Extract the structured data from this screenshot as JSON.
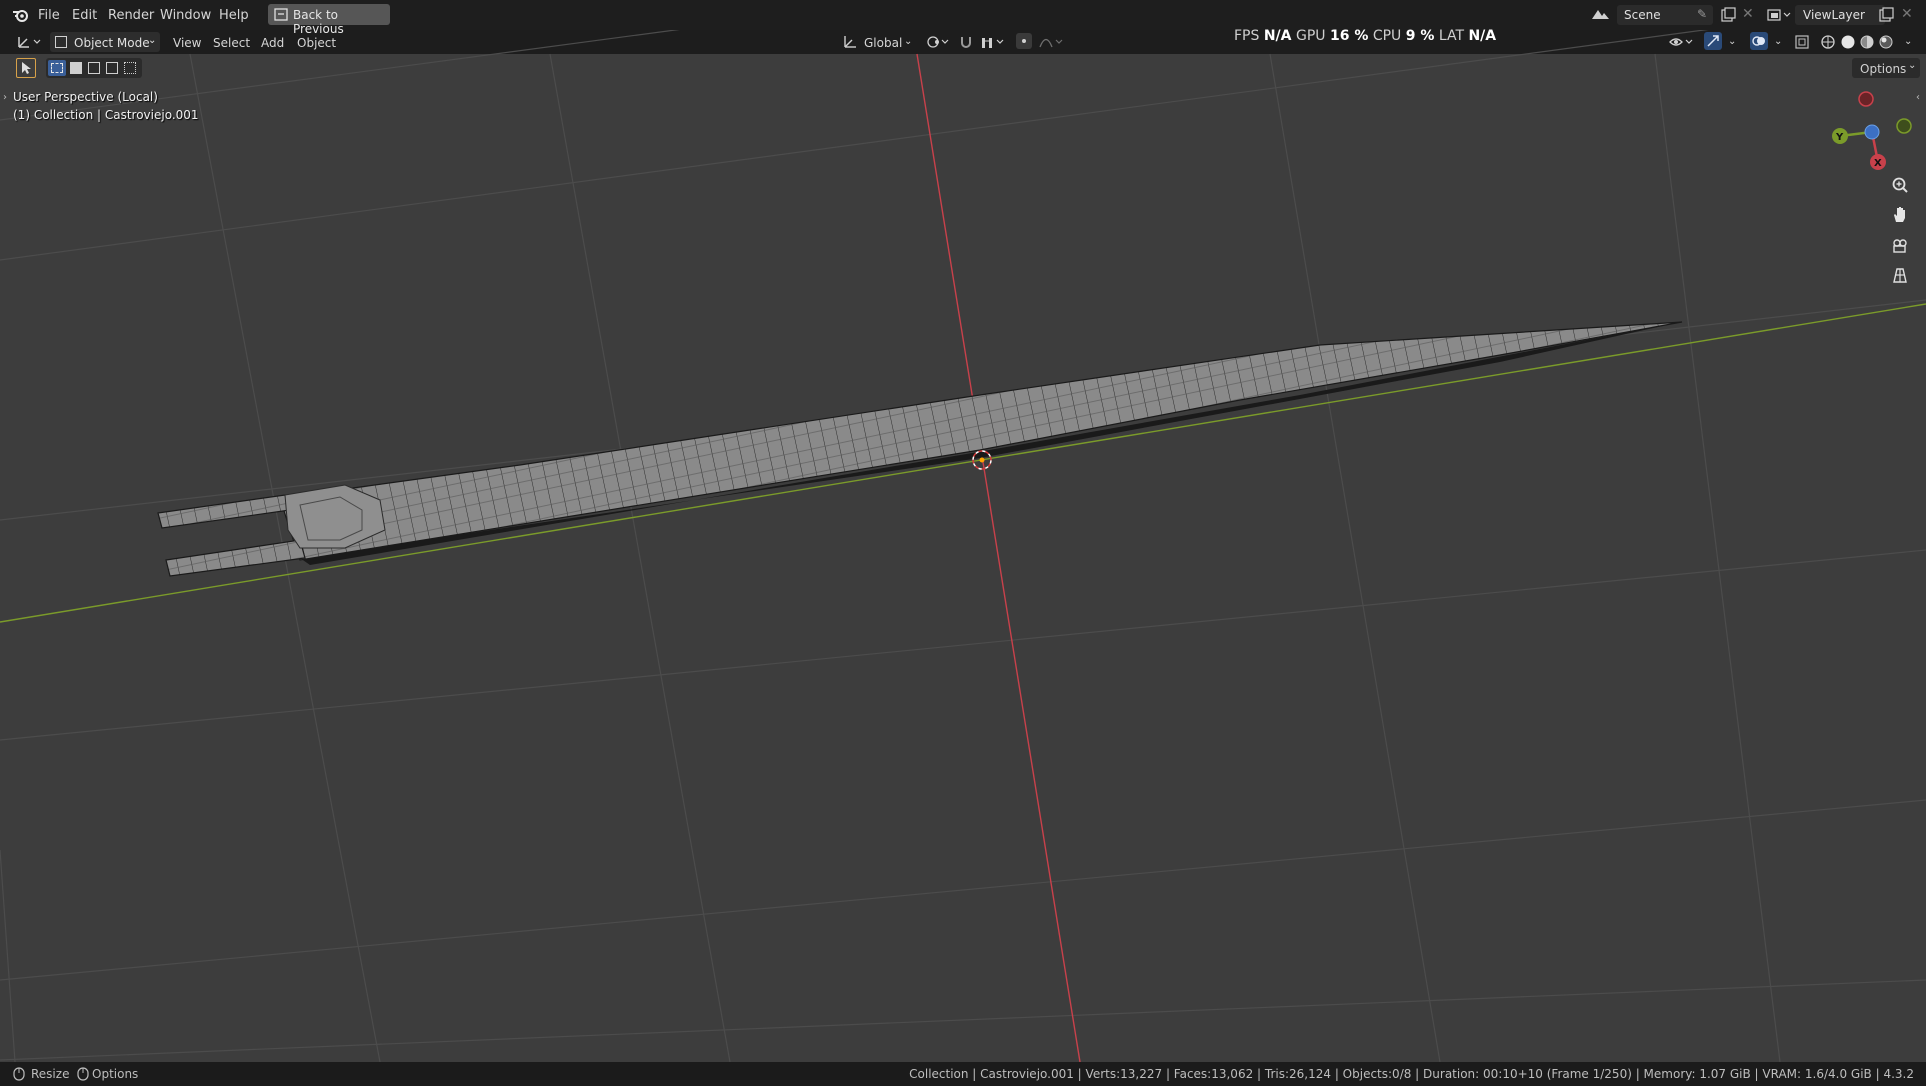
{
  "menubar": {
    "items": [
      "File",
      "Edit",
      "Render",
      "Window",
      "Help"
    ],
    "back_button": "Back to Previous",
    "scene": "Scene",
    "view_layer": "ViewLayer"
  },
  "header": {
    "mode": "Object Mode",
    "menus": [
      "View",
      "Select",
      "Add",
      "Object"
    ],
    "orientation": "Global",
    "options": "Options"
  },
  "stats": {
    "fps_label": "FPS",
    "fps": "N/A",
    "gpu_label": "GPU",
    "gpu": "16 %",
    "cpu_label": "CPU",
    "cpu": "9 %",
    "lat_label": "LAT",
    "lat": "N/A"
  },
  "viewport": {
    "perspective": "User Perspective (Local)",
    "collection": "(1) Collection | Castroviejo.001"
  },
  "gizmo": {
    "axes": [
      "Y",
      "X"
    ]
  },
  "status": {
    "resize": "Resize",
    "options": "Options",
    "info": "Collection | Castroviejo.001 | Verts:13,227 | Faces:13,062 | Tris:26,124 | Objects:0/8 | Duration: 00:10+10 (Frame 1/250) | Memory: 1.07 GiB | VRAM: 1.6/4.0 GiB | 4.3.2"
  },
  "colors": {
    "x_axis": "#c8414b",
    "y_axis": "#7b9b2a",
    "z_axis": "#3f7fd1",
    "background": "#3d3d3d"
  },
  "icons": [
    "blender-logo-icon",
    "editor-type-icon",
    "object-mode-icon",
    "select-box-icon",
    "transform-orientation-icon",
    "pivot-icon",
    "snap-icon",
    "proportional-edit-icon",
    "scene-icon",
    "view-layer-icon",
    "zoom-icon",
    "pan-hand-icon",
    "camera-icon",
    "grid-icon"
  ]
}
